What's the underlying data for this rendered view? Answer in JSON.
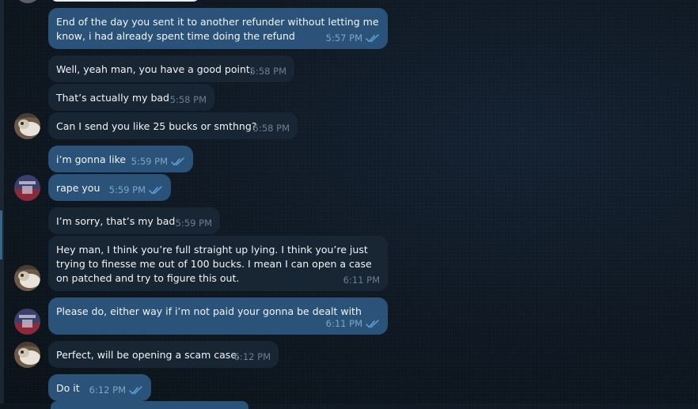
{
  "conversation": {
    "messages": [
      {
        "dir": "out",
        "text": "End of the day you sent it to another refunder without letting me know, i had already spent time doing the refund",
        "time": "5:57 PM",
        "read": true
      },
      {
        "dir": "in",
        "text": "Well, yeah man, you have a good point.",
        "time": "5:58 PM"
      },
      {
        "dir": "in",
        "text": "That’s actually my bad",
        "time": "5:58 PM"
      },
      {
        "dir": "in",
        "text": "Can I send you like 25 bucks or smthng?",
        "time": "5:58 PM"
      },
      {
        "dir": "out",
        "text": "i’m gonna like",
        "time": "5:59 PM",
        "read": true
      },
      {
        "dir": "out",
        "text": "rape you",
        "time": "5:59 PM",
        "read": true
      },
      {
        "dir": "in",
        "text": "I’m sorry, that’s my bad",
        "time": "5:59 PM"
      },
      {
        "dir": "in",
        "text": "Hey man, I think you’re full straight up lying. I think you’re just trying to finesse me out of 100 bucks. I mean I can open a case on patched and try to figure this out.",
        "time": "6:11 PM"
      },
      {
        "dir": "out",
        "text": "Please do, either way if i’m not paid your gonna be dealt with",
        "time": "6:11 PM",
        "read": true
      },
      {
        "dir": "in",
        "text": "Perfect, will be opening a scam case.",
        "time": "6:12 PM"
      },
      {
        "dir": "out",
        "text": "Do it",
        "time": "6:12 PM",
        "read": true
      }
    ]
  },
  "avatars": {
    "me": {
      "icon": "user-avatar-icon",
      "colors": [
        "#3a3f6e",
        "#8a2a3a",
        "#c9c9d8"
      ]
    },
    "contact": {
      "icon": "contact-avatar-icon",
      "colors": [
        "#6b5a4a",
        "#e8e2d8",
        "#3a2e24"
      ]
    }
  },
  "theme": {
    "outgoing_bubble": "#2b5278",
    "incoming_bubble": "#182533",
    "read_ticks": "#5fa3de",
    "background": "#0e1620"
  }
}
